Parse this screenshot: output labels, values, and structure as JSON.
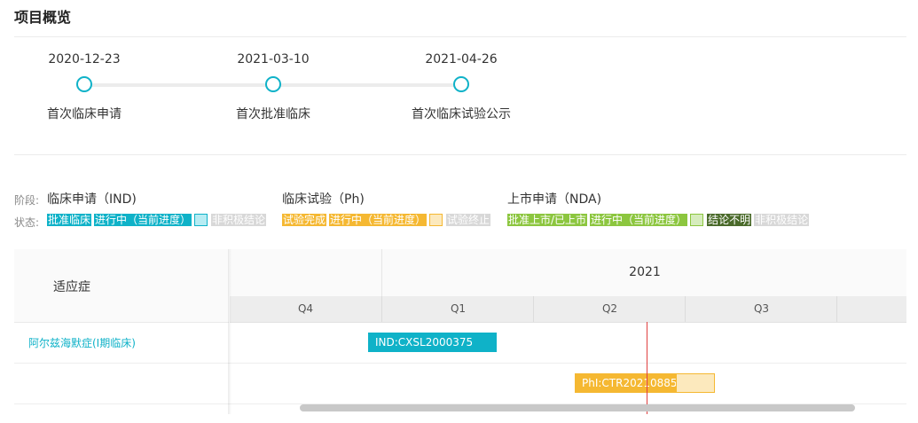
{
  "page": {
    "title": "项目概览"
  },
  "timeline": [
    {
      "date": "2020-12-23",
      "label": "首次临床申请"
    },
    {
      "date": "2021-03-10",
      "label": "首次批准临床"
    },
    {
      "date": "2021-04-26",
      "label": "首次临床试验公示"
    }
  ],
  "legend": {
    "phase_label": "阶段:",
    "status_label": "状态:",
    "phases": [
      {
        "name": "临床申请（IND)",
        "tags": [
          "批准临床",
          "进行中（当前进度）",
          "非积极结论"
        ]
      },
      {
        "name": "临床试验（Ph)",
        "tags": [
          "试验完成",
          "进行中（当前进度）",
          "试验终止"
        ]
      },
      {
        "name": "上市申请（NDA)",
        "tags": [
          "批准上市/已上市",
          "进行中（当前进度）",
          "结论不明",
          "非积极结论"
        ]
      }
    ]
  },
  "colors": {
    "ind": "#0fb2c8",
    "ind_light": "#b7ecf3",
    "ph": "#f5b832",
    "ph_light": "#fce9bd",
    "nda": "#8cc63f",
    "nda_light": "#d6ecbd",
    "unclear": "#4a6a2a",
    "negative": "#d8d8d8",
    "now_line": "#e04040"
  },
  "gantt": {
    "left_header": "适应症",
    "year": "2021",
    "quarters": [
      "Q4",
      "Q1",
      "Q2",
      "Q3"
    ],
    "rows": [
      {
        "indication": "阿尔兹海默症(I期临床)",
        "bar": "IND:CXSL2000375"
      },
      {
        "indication": "",
        "bar": "PhI:CTR20210885"
      }
    ]
  }
}
